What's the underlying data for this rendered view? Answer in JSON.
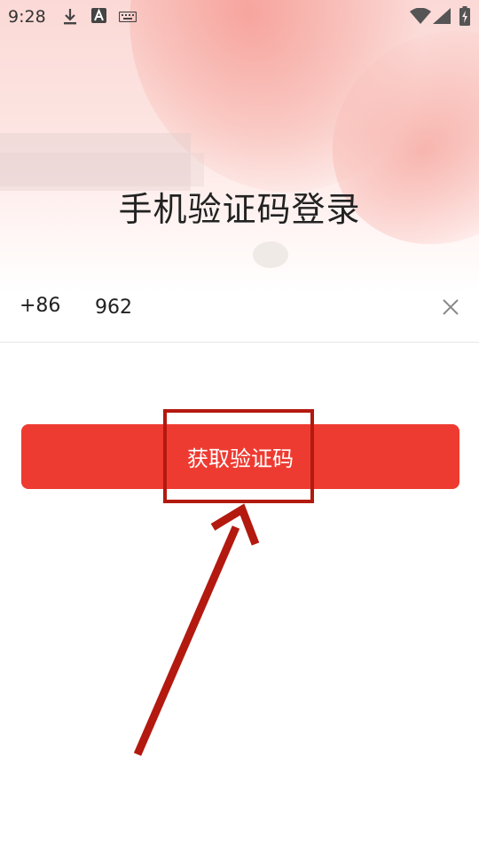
{
  "status_bar": {
    "time": "9:28",
    "icons": [
      "download-icon",
      "font-a-icon",
      "keyboard-icon",
      "wifi-icon",
      "cell-signal-icon",
      "battery-charging-icon"
    ]
  },
  "login": {
    "title": "手机验证码登录",
    "country_code": "+86",
    "phone_value": "962",
    "clear_icon": "close-icon",
    "get_code_label": "获取验证码"
  },
  "colors": {
    "primary_button": "#ee3b31",
    "annotation": "#b3190f",
    "header_gradient": "#fbd9d6"
  }
}
